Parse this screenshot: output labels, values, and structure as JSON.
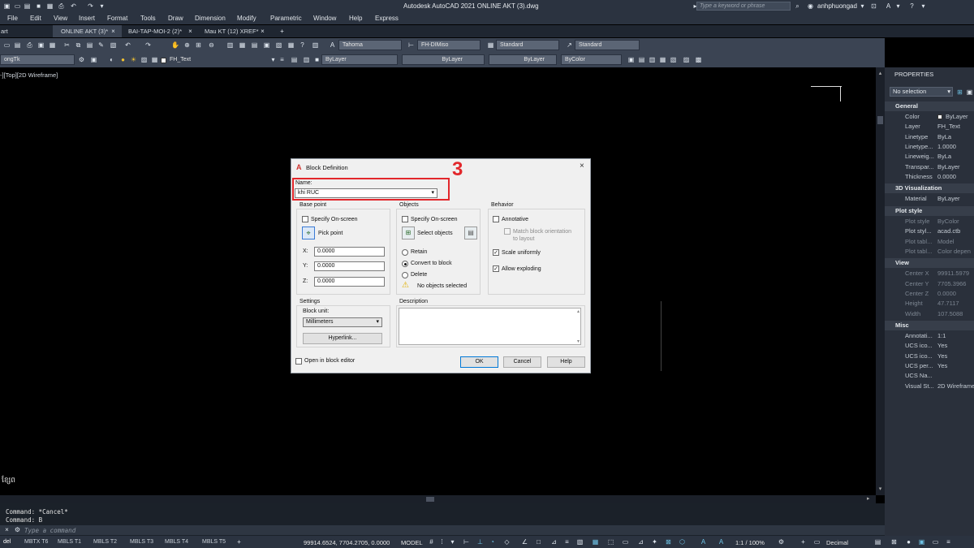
{
  "titlebar": {
    "title": "Autodesk AutoCAD 2021    ONLINE AKT (3).dwg",
    "search_placeholder": "Type a keyword or phrase",
    "user": "anhphuongad"
  },
  "menu": [
    "File",
    "Edit",
    "View",
    "Insert",
    "Format",
    "Tools",
    "Draw",
    "Dimension",
    "Modify",
    "Parametric",
    "Window",
    "Help",
    "Express"
  ],
  "tabs": [
    {
      "label": "art"
    },
    {
      "label": "ONLINE AKT (3)*"
    },
    {
      "label": "BAI-TAP-MOI-2 (2)*"
    },
    {
      "label": "Mau KT (12) XREF*"
    }
  ],
  "toolbar1": {
    "text_style": "Tahoma",
    "dim_style": "FH-DIMiso",
    "table_style": "Standard",
    "ml_style": "Standard"
  },
  "toolbar2": {
    "layer_left": "ongTk",
    "layer": "FH_Text",
    "color": "ByLayer",
    "linetype": "ByLayer",
    "lineweight": "ByLayer",
    "plotstyle": "ByColor"
  },
  "viewport_label": "-][Top][2D Wireframe]",
  "properties": {
    "title": "PROPERTIES",
    "selection": "No selection",
    "sections": [
      {
        "name": "General",
        "rows": [
          {
            "k": "Color",
            "v": "ByLayer"
          },
          {
            "k": "Layer",
            "v": "FH_Text"
          },
          {
            "k": "Linetype",
            "v": "ByLa"
          },
          {
            "k": "Linetype...",
            "v": "1.0000"
          },
          {
            "k": "Lineweig...",
            "v": "ByLa"
          },
          {
            "k": "Transpar...",
            "v": "ByLayer"
          },
          {
            "k": "Thickness",
            "v": "0.0000"
          }
        ]
      },
      {
        "name": "3D Visualization",
        "rows": [
          {
            "k": "Material",
            "v": "ByLayer"
          }
        ]
      },
      {
        "name": "Plot style",
        "rows": [
          {
            "k": "Plot style",
            "v": "ByColor"
          },
          {
            "k": "Plot styl...",
            "v": "acad.ctb"
          },
          {
            "k": "Plot tabl...",
            "v": "Model"
          },
          {
            "k": "Plot tabl...",
            "v": "Color depen"
          }
        ]
      },
      {
        "name": "View",
        "rows": [
          {
            "k": "Center X",
            "v": "99911.5979"
          },
          {
            "k": "Center Y",
            "v": "7705.3966"
          },
          {
            "k": "Center Z",
            "v": "0.0000"
          },
          {
            "k": "Height",
            "v": "47.7117"
          },
          {
            "k": "Width",
            "v": "107.5088"
          }
        ]
      },
      {
        "name": "Misc",
        "rows": [
          {
            "k": "Annotati...",
            "v": "1:1"
          },
          {
            "k": "UCS ico...",
            "v": "Yes"
          },
          {
            "k": "UCS ico...",
            "v": "Yes"
          },
          {
            "k": "UCS per...",
            "v": "Yes"
          },
          {
            "k": "UCS Na...",
            "v": ""
          },
          {
            "k": "Visual St...",
            "v": "2D Wireframe"
          }
        ]
      }
    ]
  },
  "dialog": {
    "title": "Block Definition",
    "name_label": "Name:",
    "name_value": "khi RUC",
    "annotation_number": "3",
    "base_point": {
      "label": "Base point",
      "specify": "Specify On-screen",
      "pick": "Pick point",
      "x_label": "X:",
      "y_label": "Y:",
      "z_label": "Z:",
      "x": "0.0000",
      "y": "0.0000",
      "z": "0.0000"
    },
    "objects": {
      "label": "Objects",
      "specify": "Specify On-screen",
      "select": "Select objects",
      "retain": "Retain",
      "convert": "Convert to block",
      "delete": "Delete",
      "warning": "No objects selected"
    },
    "behavior": {
      "label": "Behavior",
      "annotative": "Annotative",
      "match1": "Match block orientation",
      "match2": "to layout",
      "scale": "Scale uniformly",
      "explode": "Allow exploding"
    },
    "settings": {
      "label": "Settings",
      "unit_label": "Block unit:",
      "unit": "Millimeters",
      "hyperlink": "Hyperlink..."
    },
    "description_label": "Description",
    "open_editor": "Open in block editor",
    "ok": "OK",
    "cancel": "Cancel",
    "help": "Help"
  },
  "command": {
    "line1": "Command: *Cancel*",
    "line2": "Command: B",
    "placeholder": "Type a command"
  },
  "status": {
    "layout_tabs": [
      "del",
      "MBTX T6",
      "MBLS T1",
      "MBLS T2",
      "MBLS T3",
      "MBLS T4",
      "MBLS T5"
    ],
    "coords": "99914.6524, 7704.2705, 0.0000",
    "model": "MODEL",
    "scale": "1:1 / 100%",
    "units": "Decimal"
  },
  "canvas_text": "ខ្សែព"
}
